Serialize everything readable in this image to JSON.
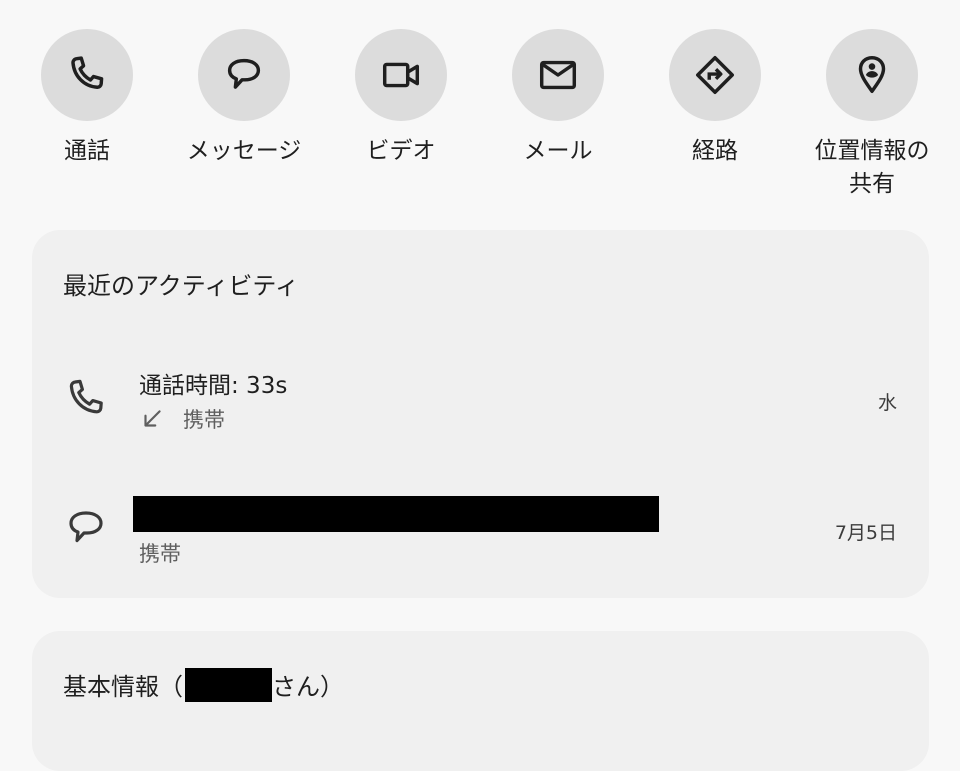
{
  "actions": [
    {
      "label": "通話",
      "icon": "phone-icon"
    },
    {
      "label": "メッセージ",
      "icon": "message-icon"
    },
    {
      "label": "ビデオ",
      "icon": "video-icon"
    },
    {
      "label": "メール",
      "icon": "mail-icon"
    },
    {
      "label": "経路",
      "icon": "directions-icon"
    },
    {
      "label": "位置情報の共有",
      "icon": "location-share-icon"
    }
  ],
  "recent_activity": {
    "title": "最近のアクティビティ",
    "items": [
      {
        "icon": "phone-icon",
        "primary": "通話時間: 33s",
        "direction_icon": "incoming-arrow-icon",
        "secondary": "携帯",
        "time": "水"
      },
      {
        "icon": "message-icon",
        "primary": "",
        "secondary": "携帯",
        "time": "7月5日"
      }
    ]
  },
  "basic_info": {
    "title_prefix": "基本情報（",
    "title_suffix": "さん）"
  },
  "colors": {
    "background": "#f8f8f8",
    "card": "#f0f0f0",
    "action_circle": "#dcdcdc"
  }
}
